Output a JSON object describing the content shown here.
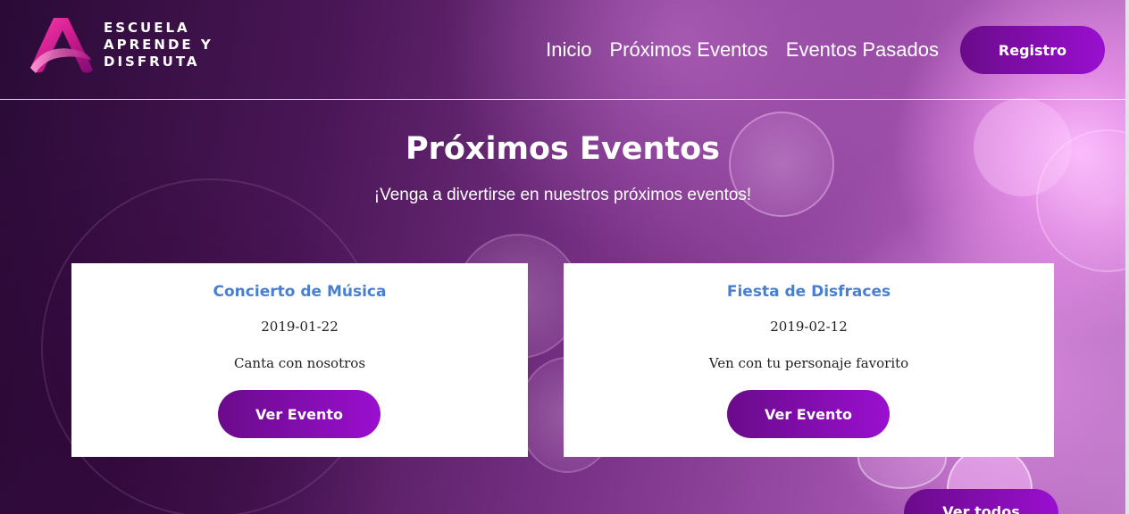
{
  "header": {
    "logo": {
      "line1": "ESCUELA",
      "line2": "APRENDE Y",
      "line3": "DISFRUTA",
      "icon": "letter-a-logo-icon"
    },
    "nav": {
      "home": "Inicio",
      "upcoming": "Próximos Eventos",
      "past": "Eventos Pasados",
      "register": "Registro"
    }
  },
  "hero": {
    "title": "Próximos Eventos",
    "subtitle": "¡Venga a divertirse en nuestros próximos eventos!"
  },
  "events": [
    {
      "title": "Concierto de Música",
      "date": "2019-01-22",
      "description": "Canta con nosotros",
      "button": "Ver Evento"
    },
    {
      "title": "Fiesta de Disfraces",
      "date": "2019-02-12",
      "description": "Ven con tu personaje favorito",
      "button": "Ver Evento"
    }
  ],
  "see_all": "Ver todos",
  "colors": {
    "button_start": "#6a0b8a",
    "button_end": "#9a0fd0",
    "card_title": "#4a7fd0",
    "logo_pink": "#e0208f"
  }
}
